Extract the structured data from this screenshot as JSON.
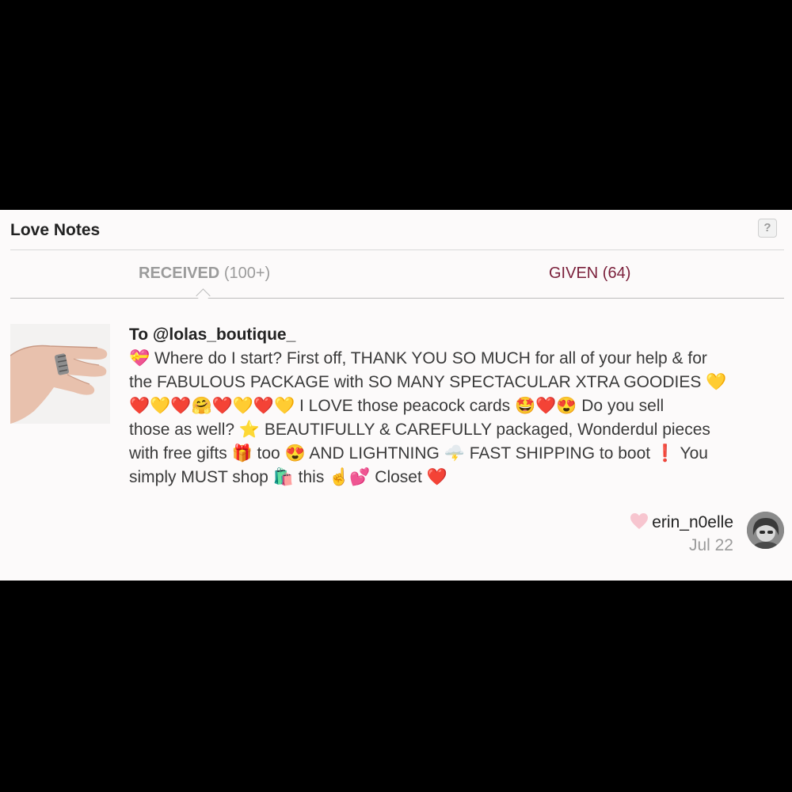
{
  "header": {
    "title": "Love Notes",
    "help_label": "?"
  },
  "tabs": {
    "received_label": "RECEIVED",
    "received_count": "(100+)",
    "given_label": "GIVEN (64)"
  },
  "note": {
    "to": "To @lolas_boutique_",
    "lines": [
      "💝 Where do I start? First off, THANK YOU SO MUCH for all of your help & for",
      "the FABULOUS PACKAGE with SO MANY SPECTACULAR XTRA GOODIES 💛",
      "❤️💛❤️🤗❤️💛❤️💛 I LOVE those peacock cards 🤩❤️😍 Do you sell",
      "those as well? ⭐ BEAUTIFULLY & CAREFULLY packaged, Wonderdul pieces",
      "with free gifts 🎁 too 😍 AND LIGHTNING 🌩️ FAST SHIPPING to boot ❗ You",
      "simply MUST shop 🛍️ this ☝️💕 Closet ❤️"
    ],
    "author": "erin_n0elle",
    "date": "Jul 22"
  },
  "colors": {
    "given_tab": "#7a1f3a",
    "received_tab": "#9b9b9b",
    "like_heart": "#f7c5cf"
  },
  "icons": {
    "help": "help-icon",
    "like": "heart-icon"
  }
}
